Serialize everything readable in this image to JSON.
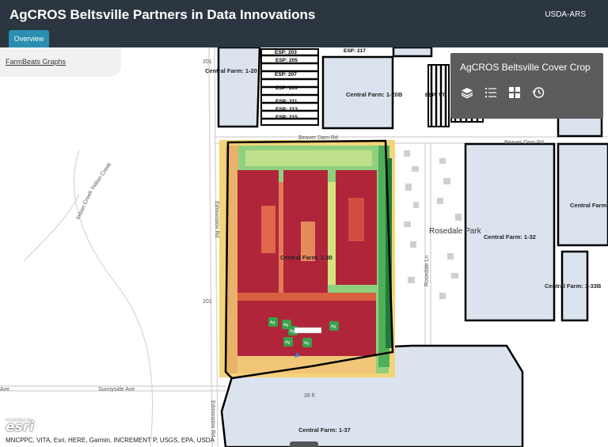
{
  "header": {
    "title": "AgCROS Beltsville Partners in Data Innovations",
    "org": "USDA-ARS"
  },
  "tabs": [
    {
      "label": "Overview"
    }
  ],
  "graphs_link": {
    "label": "FarmBeats Graphs"
  },
  "widget": {
    "title": "AgCROS Beltsville Cover Crop",
    "tools": [
      "layers-icon",
      "legend-icon",
      "basemap-gallery-icon",
      "history-icon"
    ]
  },
  "map": {
    "roads": {
      "beaver_dam": "Beaver Dam Rd",
      "sunnyside": "Sunnyside Ave",
      "edmonston": "Edmonston Rd",
      "rosedale": "Rosedale Ln",
      "indian_creek": "Indian Creek",
      "route": "201",
      "elevation": "39 ft",
      "ave": "Ave"
    },
    "places": {
      "rosedale_park": "Rosedale Park"
    },
    "parcels": {
      "cf_120": "Central Farm: 1-20",
      "cf_120b": "Central Farm: 1-20B",
      "cf_130": "Central Farm: 1-30",
      "cf_132": "Central Farm: 1-32",
      "cf_133b": "Central Farm: 1-33B",
      "cf_137": "Central Farm: 1-37",
      "cf_right": "Central Farm",
      "esp_203": "ESP: 203",
      "esp_205": "ESP: 205",
      "esp_207": "ESP: 207",
      "esp_209": "ESP: 209",
      "esp_211": "ESP: 211",
      "esp_213": "ESP: 213",
      "esp_215": "ESP: 215",
      "esp_217": "ESP: 217",
      "esp_vt": "ESP: VT"
    },
    "sensor_label": "Ag"
  },
  "footer": {
    "esri": "esri",
    "powered": "POWERED BY",
    "attribution": "MNCPPC, VITA, Esri, HERE, Garmin, INCREMENT P, USGS, EPA, USDA"
  },
  "colors": {
    "header_bg": "#2b3640",
    "tab_bg": "#2a8fb0",
    "parcel_fill": "#dbe3ef",
    "heat_high": "#b0253a",
    "heat_low": "#1e7d3c",
    "widget_bg": "#5c5c5c"
  }
}
